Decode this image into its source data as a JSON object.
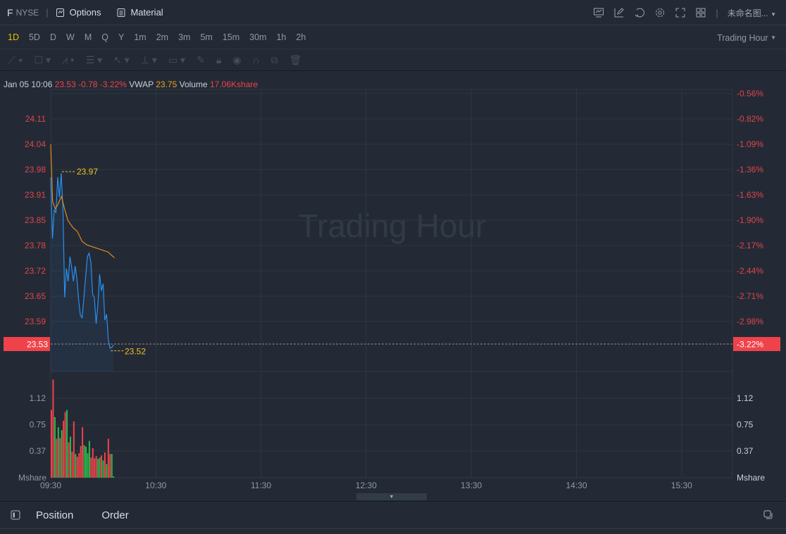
{
  "header": {
    "symbol": "F",
    "exchange": "NYSE",
    "options_label": "Options",
    "material_label": "Material",
    "layout_name": "未命名图..."
  },
  "periods": [
    "1D",
    "5D",
    "D",
    "W",
    "M",
    "Q",
    "Y",
    "1m",
    "2m",
    "3m",
    "5m",
    "15m",
    "30m",
    "1h",
    "2h"
  ],
  "active_period": "1D",
  "session_selector": "Trading Hour",
  "info": {
    "time": "Jan 05 10:06",
    "price": "23.53",
    "change": "-0.78",
    "change_pct": "-3.22%",
    "vwap_label": "VWAP",
    "vwap": "23.75",
    "volume_label": "Volume",
    "volume": "17.06Kshare"
  },
  "watermark": "Trading Hour",
  "bottom_tabs": {
    "position": "Position",
    "order": "Order"
  },
  "colors": {
    "up": "#f0424a",
    "down": "#2db84d",
    "price_line": "#2b8ff0",
    "vwap_line": "#e08a1e",
    "label": "#f0c020"
  },
  "chart_data": {
    "type": "line",
    "price_ticks": [
      "24.11",
      "24.04",
      "23.98",
      "23.91",
      "23.85",
      "23.78",
      "23.72",
      "23.65",
      "23.59"
    ],
    "pct_ticks": [
      "-0.56%",
      "-0.82%",
      "-1.09%",
      "-1.36%",
      "-1.63%",
      "-1.90%",
      "-2.17%",
      "-2.44%",
      "-2.71%",
      "-2.98%"
    ],
    "current_price": "23.53",
    "current_pct": "-3.22%",
    "high_label": "23.97",
    "low_label": "23.52",
    "volume_ticks": [
      "1.12",
      "0.75",
      "0.37"
    ],
    "volume_unit": "Mshare",
    "x_ticks": [
      "09:30",
      "10:30",
      "11:30",
      "12:30",
      "13:30",
      "14:30",
      "15:30"
    ],
    "price": [
      23.956,
      23.799,
      23.872,
      23.866,
      23.956,
      23.905,
      23.966,
      23.875,
      23.649,
      23.723,
      23.69,
      23.753,
      23.726,
      23.69,
      23.729,
      23.696,
      23.642,
      23.603,
      23.597,
      23.648,
      23.702,
      23.753,
      23.762,
      23.738,
      23.657,
      23.648,
      23.582,
      23.63,
      23.708,
      23.666,
      23.684,
      23.591,
      23.606,
      23.54,
      23.519,
      23.522,
      23.528
    ],
    "vwap": [
      [
        0,
        24.04
      ],
      [
        1.1,
        23.893
      ],
      [
        2.6,
        23.875
      ],
      [
        4.2,
        23.887
      ],
      [
        6.2,
        23.907
      ],
      [
        7.9,
        23.875
      ],
      [
        9.9,
        23.845
      ],
      [
        12.6,
        23.828
      ],
      [
        15.3,
        23.817
      ],
      [
        18,
        23.792
      ],
      [
        20.7,
        23.783
      ],
      [
        24.7,
        23.777
      ],
      [
        28.8,
        23.771
      ],
      [
        32.8,
        23.765
      ],
      [
        36.5,
        23.75
      ]
    ],
    "volume": [
      0.94,
      1.36,
      0.84,
      0.54,
      0.7,
      0.55,
      0.66,
      0.79,
      0.91,
      0.94,
      0.49,
      0.57,
      0.36,
      0.78,
      0.33,
      0.29,
      0.34,
      0.44,
      0.7,
      0.45,
      0.43,
      0.34,
      0.51,
      0.28,
      0.41,
      0.27,
      0.3,
      0.26,
      0.28,
      0.31,
      0.24,
      0.35,
      0.19,
      0.54,
      0.33,
      0.33,
      0.02
    ],
    "volume_dir": [
      "u",
      "u",
      "d",
      "u",
      "d",
      "u",
      "d",
      "u",
      "u",
      "d",
      "u",
      "d",
      "u",
      "u",
      "d",
      "u",
      "u",
      "u",
      "u",
      "d",
      "d",
      "d",
      "d",
      "u",
      "u",
      "u",
      "u",
      "d",
      "d",
      "u",
      "d",
      "u",
      "d",
      "u",
      "u",
      "d",
      "d"
    ]
  }
}
